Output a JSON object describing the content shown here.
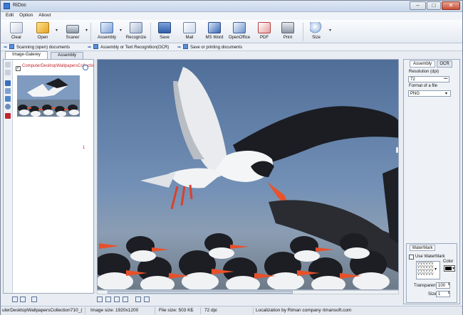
{
  "window": {
    "title": "RiDoc",
    "min": "–",
    "max": "□",
    "close": "✕"
  },
  "menu": [
    "Edit",
    "Option",
    "About"
  ],
  "toolbar": {
    "clear": "Clear",
    "open": "Open",
    "scaner": "Scaner",
    "assembly": "Assembly",
    "recognize": "Recognize",
    "save": "Save",
    "mail": "Mail",
    "msword": "MS Word",
    "openoffice": "OpenOffice",
    "pdf": "PDF",
    "print": "Print",
    "size": "Size"
  },
  "steps": {
    "scan": "Scanning (open) documents",
    "assembly": "Assembly or Text Recognition(OCR)",
    "save": "Save or printing documents"
  },
  "left_tabs": {
    "gallery": "Image-Galerey",
    "assembly": "Assembly"
  },
  "gallery": {
    "checked": "✓",
    "filename": "ComputerDesktopWallpapersCollection710_057.jpg",
    "page": "1"
  },
  "right_tabs": {
    "assembly": "Assembly",
    "ocr": "OCR"
  },
  "settings": {
    "resolution_label": "Resolution (dpi)",
    "resolution_value": "72",
    "resolution_more": "•••",
    "format_label": "Format of a file",
    "format_value": "PNG"
  },
  "watermark": {
    "tab": "WaterMark",
    "use_label": "Use WaterMark",
    "color_label": "Color",
    "grid": "VVVVVV VVVVVV VVVVVV VVVVVV",
    "transparent_label": "Transparent",
    "transparent_value": "100",
    "size_label": "Size",
    "size_value": "1"
  },
  "status": {
    "file": "uterDesktopWallpapersCollection710_(",
    "image_size": "Image size: 1920x1200",
    "file_size": "File size: 503 KБ",
    "dpi": "72 dpi",
    "localization": "Localization by Riman company rimansoft.com"
  },
  "colors": {
    "accent": "#3b6fbf",
    "filename": "#c0262d",
    "sky": "#5d7aa2"
  }
}
